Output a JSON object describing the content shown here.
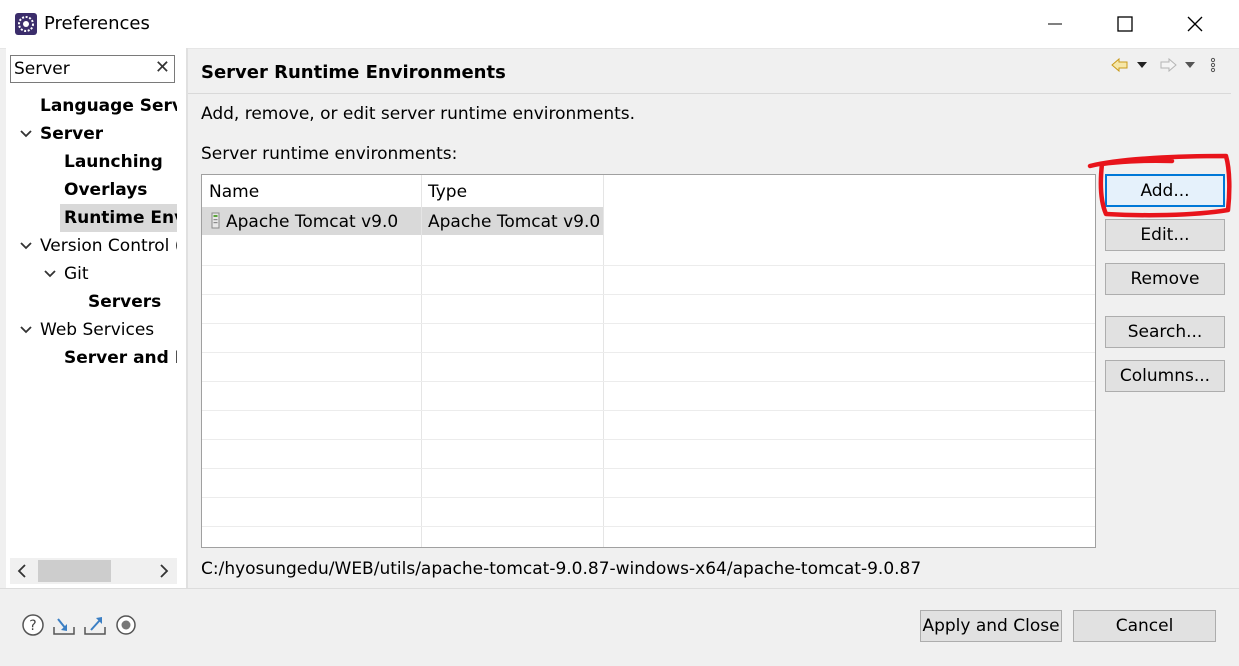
{
  "window": {
    "title": "Preferences"
  },
  "filter": {
    "value": "Server",
    "placeholder": ""
  },
  "tree": {
    "items": [
      {
        "label": "Language Serve",
        "bold": true
      },
      {
        "label": "Server",
        "bold": true
      },
      {
        "label": "Launching",
        "bold": true
      },
      {
        "label": "Overlays",
        "bold": true
      },
      {
        "label": "Runtime Envi",
        "bold": true
      },
      {
        "label": "Version Control (",
        "bold": false
      },
      {
        "label": "Git",
        "bold": false
      },
      {
        "label": "Servers",
        "bold": true
      },
      {
        "label": "Web Services",
        "bold": false
      },
      {
        "label": "Server and Ru",
        "bold": true
      }
    ]
  },
  "page": {
    "title": "Server Runtime Environments",
    "description": "Add, remove, or edit server runtime environments.",
    "list_label": "Server runtime environments:"
  },
  "table": {
    "columns": [
      "Name",
      "Type"
    ],
    "rows": [
      {
        "name": "Apache Tomcat v9.0",
        "type": "Apache Tomcat v9.0",
        "selected": true
      }
    ]
  },
  "buttons": {
    "add": "Add...",
    "edit": "Edit...",
    "remove": "Remove",
    "search": "Search...",
    "columns": "Columns..."
  },
  "path": "C:/hyosungedu/WEB/utils/apache-tomcat-9.0.87-windows-x64/apache-tomcat-9.0.87",
  "footer": {
    "apply_close": "Apply and Close",
    "cancel": "Cancel"
  },
  "colors": {
    "selection": "#d9d9d9",
    "annotation": "#e8141b",
    "focus": "#0078d7"
  }
}
